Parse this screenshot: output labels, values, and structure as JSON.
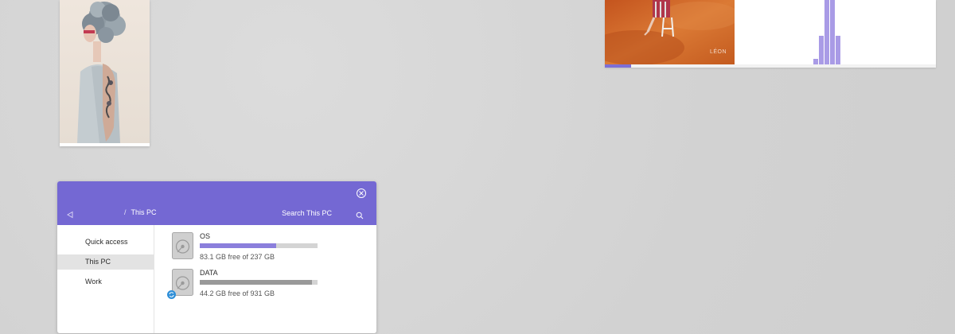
{
  "colors": {
    "accent": "#7468d3",
    "os_bar": "#8b7fdc",
    "data_bar": "#999999",
    "visualizer": "#a99be6",
    "progress": "#7d6fd6"
  },
  "music": {
    "album_label": "LÉON",
    "progress_fraction": 0.08,
    "visualizer_levels": [
      0.09,
      0.45,
      1.0,
      1.0,
      0.45
    ]
  },
  "explorer": {
    "back_icon": "back-arrow-icon",
    "close_icon": "close-icon",
    "breadcrumb": {
      "separator": "/",
      "current": "This PC"
    },
    "search": {
      "placeholder": "Search This PC",
      "icon": "search-icon"
    },
    "nav": {
      "items": [
        {
          "label": "Quick access",
          "selected": false
        },
        {
          "label": "This PC",
          "selected": true
        },
        {
          "label": "Work",
          "selected": false
        }
      ]
    },
    "drives": [
      {
        "name": "OS",
        "free_text": "83.1 GB free of 237 GB",
        "used_fraction": 0.65,
        "icon": "hard-drive-icon",
        "badge": ""
      },
      {
        "name": "DATA",
        "free_text": "44.2 GB free of 931 GB",
        "used_fraction": 0.95,
        "icon": "hard-drive-icon",
        "badge": "sync-icon"
      }
    ]
  }
}
